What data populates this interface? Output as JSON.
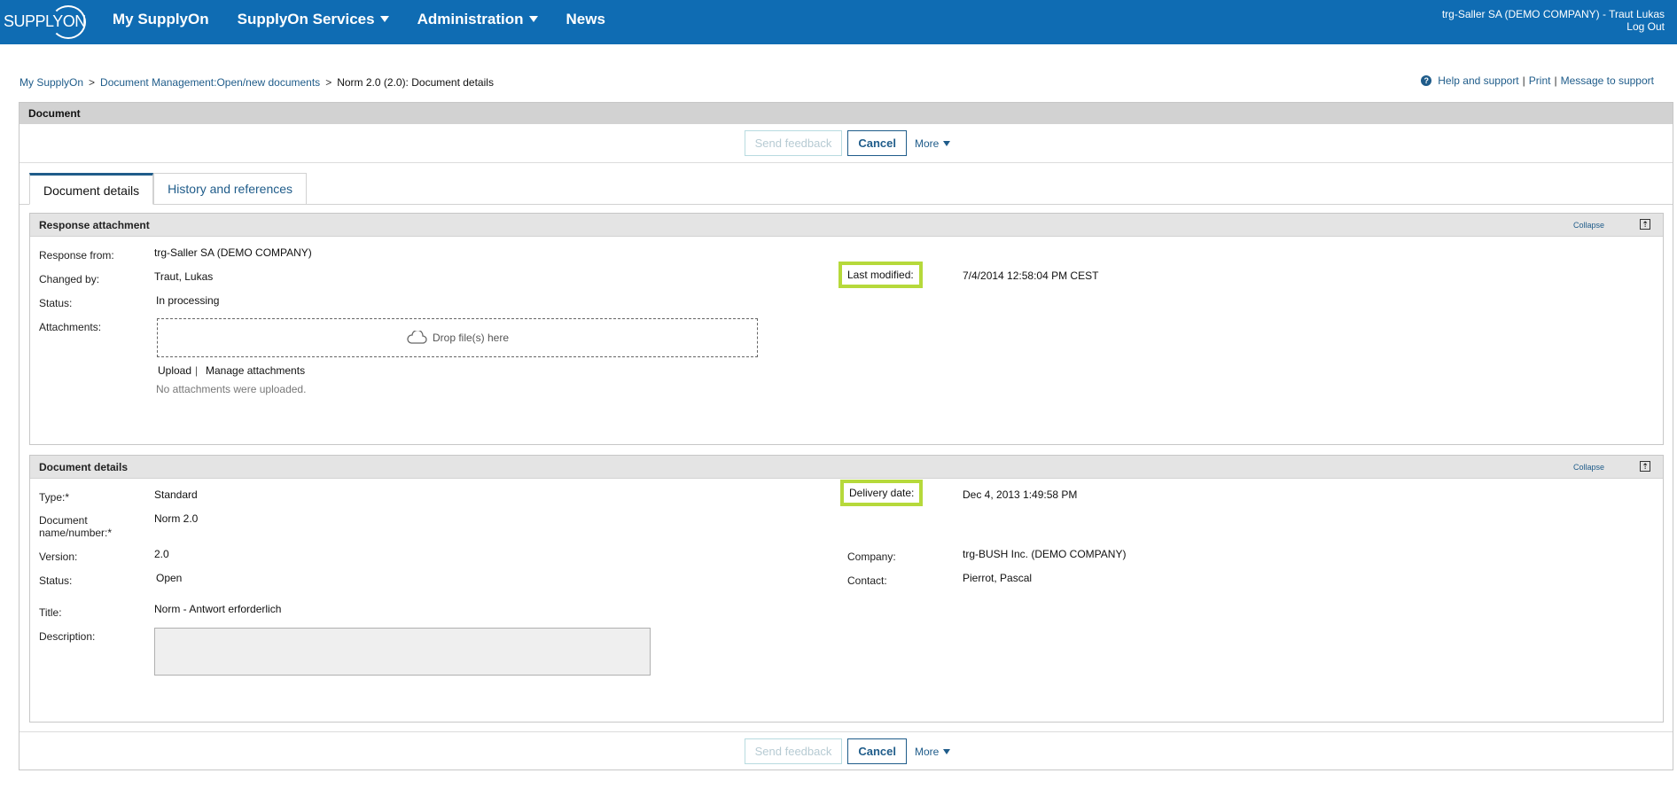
{
  "header": {
    "logo_text": "SUPPLYON",
    "nav": [
      {
        "label": "My SupplyOn",
        "has_menu": false
      },
      {
        "label": "SupplyOn Services",
        "has_menu": true
      },
      {
        "label": "Administration",
        "has_menu": true
      },
      {
        "label": "News",
        "has_menu": false
      }
    ],
    "user": "trg-Saller SA (DEMO COMPANY) - Traut Lukas",
    "logout": "Log Out"
  },
  "breadcrumb": {
    "items": [
      "My SupplyOn",
      "Document Management:Open/new documents"
    ],
    "current": "Norm 2.0 (2.0): Document details",
    "separator": ">"
  },
  "help": {
    "help_support": "Help and support",
    "print": "Print",
    "message": "Message to support",
    "divider": "|"
  },
  "panel": {
    "title": "Document",
    "actions": {
      "send_feedback": "Send feedback",
      "cancel": "Cancel",
      "more": "More"
    }
  },
  "tabs": [
    {
      "label": "Document details",
      "active": true
    },
    {
      "label": "History and references",
      "active": false
    }
  ],
  "response_attachment": {
    "title": "Response attachment",
    "collapse": "Collapse",
    "collapse_icon": "⇡",
    "response_from_label": "Response from:",
    "response_from": "trg-Saller SA (DEMO COMPANY)",
    "changed_by_label": "Changed by:",
    "changed_by": "Traut, Lukas",
    "status_label": "Status:",
    "status": "In processing",
    "attachments_label": "Attachments:",
    "drop_text": "Drop file(s) here",
    "upload": "Upload",
    "link_divider": "|",
    "manage": "Manage attachments",
    "no_attachments": "No attachments were uploaded.",
    "last_modified_label": "Last modified:",
    "last_modified": "7/4/2014 12:58:04 PM CEST"
  },
  "document_details": {
    "title": "Document details",
    "collapse": "Collapse",
    "collapse_icon": "⇡",
    "type_label": "Type:*",
    "type": "Standard",
    "name_label_1": "Document",
    "name_label_2": "name/number:*",
    "name": "Norm 2.0",
    "version_label": "Version:",
    "version": "2.0",
    "status_label": "Status:",
    "status": "Open",
    "title_label": "Title:",
    "title_value": "Norm - Antwort erforderlich",
    "description_label": "Description:",
    "description": "",
    "delivery_label": "Delivery date:",
    "delivery": "Dec 4, 2013 1:49:58 PM",
    "company_label": "Company:",
    "company": "trg-BUSH Inc. (DEMO COMPANY)",
    "contact_label": "Contact:",
    "contact": "Pierrot, Pascal"
  },
  "colors": {
    "brand": "#0f6cb3",
    "link": "#1f5c8a",
    "highlight": "#b6d93b"
  }
}
